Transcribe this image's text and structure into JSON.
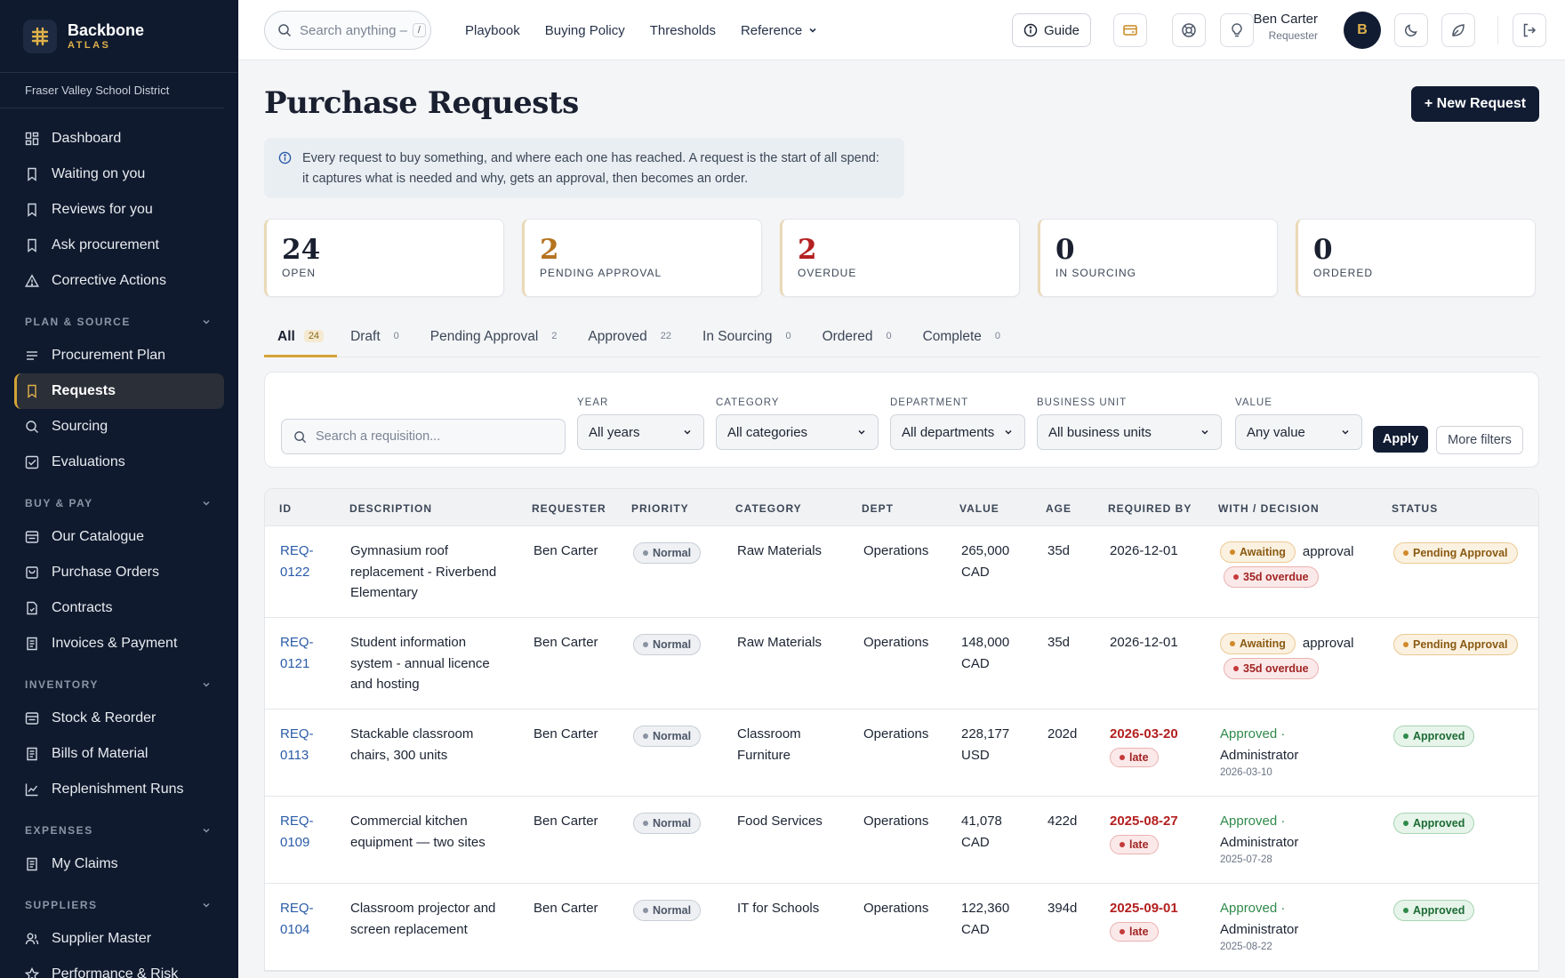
{
  "brand": {
    "name": "Backbone",
    "sub": "ATLAS",
    "org": "Fraser Valley School District"
  },
  "nav_top": [
    {
      "label": "Dashboard",
      "icon": "dashboard-icon"
    },
    {
      "label": "Waiting on you",
      "icon": "bookmark-icon"
    },
    {
      "label": "Reviews for you",
      "icon": "bookmark-icon"
    },
    {
      "label": "Ask procurement",
      "icon": "bookmark-icon"
    },
    {
      "label": "Corrective Actions",
      "icon": "warning-icon"
    }
  ],
  "sections": {
    "plan": {
      "title": "PLAN & SOURCE",
      "items": [
        "Procurement Plan",
        "Requests",
        "Sourcing",
        "Evaluations"
      ]
    },
    "buy": {
      "title": "BUY & PAY",
      "items": [
        "Our Catalogue",
        "Purchase Orders",
        "Contracts",
        "Invoices & Payment"
      ]
    },
    "inventory": {
      "title": "INVENTORY",
      "items": [
        "Stock & Reorder",
        "Bills of Material",
        "Replenishment Runs"
      ]
    },
    "expenses": {
      "title": "EXPENSES",
      "items": [
        "My Claims"
      ]
    },
    "suppliers": {
      "title": "SUPPLIERS",
      "items": [
        "Supplier Master",
        "Performance & Risk"
      ]
    }
  },
  "topbar": {
    "search_placeholder": "Search anything –",
    "search_kbd": "/",
    "links": [
      "Playbook",
      "Buying Policy",
      "Thresholds",
      "Reference"
    ],
    "guide": "Guide",
    "user_name": "Ben Carter",
    "user_role": "Requester",
    "avatar": "B"
  },
  "page": {
    "title": "Purchase Requests",
    "new_button": "+ New Request",
    "info_line1": "Every request to buy something, and where each one has reached. A request is the start of all spend:",
    "info_line2": "it captures what is needed and why, gets an approval, then becomes an order."
  },
  "stats": [
    {
      "value": "24",
      "label": "OPEN",
      "color": "#1a2030"
    },
    {
      "value": "2",
      "label": "PENDING APPROVAL",
      "color": "#b5731f"
    },
    {
      "value": "2",
      "label": "OVERDUE",
      "color": "#b42020"
    },
    {
      "value": "0",
      "label": "IN SOURCING",
      "color": "#1a2030"
    },
    {
      "value": "0",
      "label": "ORDERED",
      "color": "#1a2030"
    }
  ],
  "tabs": [
    {
      "label": "All",
      "count": "24"
    },
    {
      "label": "Draft",
      "count": "0"
    },
    {
      "label": "Pending Approval",
      "count": "2"
    },
    {
      "label": "Approved",
      "count": "22"
    },
    {
      "label": "In Sourcing",
      "count": "0"
    },
    {
      "label": "Ordered",
      "count": "0"
    },
    {
      "label": "Complete",
      "count": "0"
    }
  ],
  "filters": {
    "search_placeholder": "Search a requisition...",
    "year": {
      "label": "YEAR",
      "value": "All years"
    },
    "category": {
      "label": "CATEGORY",
      "value": "All categories"
    },
    "department": {
      "label": "DEPARTMENT",
      "value": "All departments"
    },
    "business_unit": {
      "label": "BUSINESS UNIT",
      "value": "All business units"
    },
    "value": {
      "label": "VALUE",
      "value": "Any value"
    },
    "apply": "Apply",
    "more": "More filters"
  },
  "table": {
    "columns": [
      "ID",
      "DESCRIPTION",
      "REQUESTER",
      "PRIORITY",
      "CATEGORY",
      "DEPT",
      "VALUE",
      "AGE",
      "REQUIRED BY",
      "WITH / DECISION",
      "STATUS"
    ],
    "rows": [
      {
        "id1": "REQ-",
        "id2": "0122",
        "desc": [
          "Gymnasium roof",
          "replacement - Riverbend",
          "Elementary"
        ],
        "requester": "Ben Carter",
        "priority": "Normal",
        "category": [
          "Raw Materials"
        ],
        "dept": "Operations",
        "value": [
          "265,000",
          "CAD"
        ],
        "age": "35d",
        "required": "2026-12-01",
        "late": false,
        "decision_type": "awaiting",
        "await_label": "Awaiting",
        "await_text": "approval",
        "overdue": "35d overdue",
        "status": "Pending Approval"
      },
      {
        "id1": "REQ-",
        "id2": "0121",
        "desc": [
          "Student information",
          "system - annual licence",
          "and hosting"
        ],
        "requester": "Ben Carter",
        "priority": "Normal",
        "category": [
          "Raw Materials"
        ],
        "dept": "Operations",
        "value": [
          "148,000",
          "CAD"
        ],
        "age": "35d",
        "required": "2026-12-01",
        "late": false,
        "decision_type": "awaiting",
        "await_label": "Awaiting",
        "await_text": "approval",
        "overdue": "35d overdue",
        "status": "Pending Approval"
      },
      {
        "id1": "REQ-",
        "id2": "0113",
        "desc": [
          "Stackable classroom",
          "chairs, 300 units"
        ],
        "requester": "Ben Carter",
        "priority": "Normal",
        "category": [
          "Classroom",
          "Furniture"
        ],
        "dept": "Operations",
        "value": [
          "228,177",
          "USD"
        ],
        "age": "202d",
        "required": "2026-03-20",
        "late": true,
        "late_label": "late",
        "decision_type": "approved",
        "appr_label": "Approved",
        "appr_by": "Administrator",
        "appr_date": "2026-03-10",
        "status": "Approved"
      },
      {
        "id1": "REQ-",
        "id2": "0109",
        "desc": [
          "Commercial kitchen",
          "equipment — two sites"
        ],
        "requester": "Ben Carter",
        "priority": "Normal",
        "category": [
          "Food Services"
        ],
        "dept": "Operations",
        "value": [
          "41,078",
          "CAD"
        ],
        "age": "422d",
        "required": "2025-08-27",
        "late": true,
        "late_label": "late",
        "decision_type": "approved",
        "appr_label": "Approved",
        "appr_by": "Administrator",
        "appr_date": "2025-07-28",
        "status": "Approved"
      },
      {
        "id1": "REQ-",
        "id2": "0104",
        "desc": [
          "Classroom projector and",
          "screen replacement"
        ],
        "requester": "Ben Carter",
        "priority": "Normal",
        "category": [
          "IT for Schools"
        ],
        "dept": "Operations",
        "value": [
          "122,360",
          "CAD"
        ],
        "age": "394d",
        "required": "2025-09-01",
        "late": true,
        "late_label": "late",
        "decision_type": "approved",
        "appr_label": "Approved",
        "appr_by": "Administrator",
        "appr_date": "2025-08-22",
        "status": "Approved"
      }
    ]
  }
}
